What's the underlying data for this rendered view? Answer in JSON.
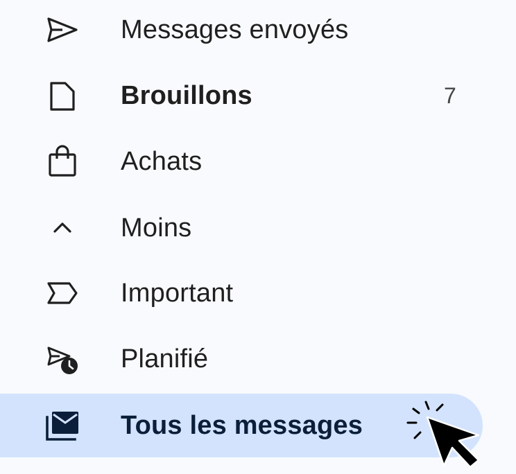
{
  "sidebar": {
    "items": [
      {
        "label": "Messages envoyés",
        "icon": "send-icon"
      },
      {
        "label": "Brouillons",
        "icon": "draft-icon",
        "count": "7"
      },
      {
        "label": "Achats",
        "icon": "shopping-bag-icon"
      },
      {
        "label": "Moins",
        "icon": "chevron-up-icon"
      },
      {
        "label": "Important",
        "icon": "important-label-icon"
      },
      {
        "label": "Planifié",
        "icon": "scheduled-send-icon"
      },
      {
        "label": "Tous les messages",
        "icon": "all-mail-icon",
        "active": true
      }
    ]
  },
  "colors": {
    "background": "#f8fafd",
    "active_background": "#d3e3fd",
    "text": "#1f1f1f",
    "active_text": "#0b1f3a",
    "icon": "#444746"
  }
}
